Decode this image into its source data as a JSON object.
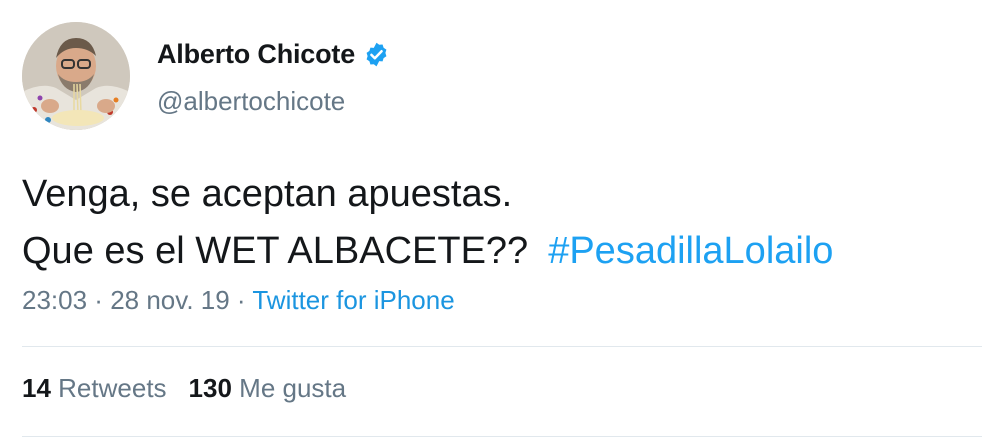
{
  "user": {
    "display_name": "Alberto Chicote",
    "handle": "@albertochicote",
    "verified_icon": "verified-badge-icon",
    "verified_color": "#1da1f2"
  },
  "tweet": {
    "line1": "Venga, se aceptan apuestas.",
    "line2": "Que es el WET ALBACETE??",
    "hashtag": "#PesadillaLolailo",
    "hashtag_color": "#1da1f2"
  },
  "meta": {
    "time": "23:03",
    "separator": " · ",
    "date": "28 nov. 19",
    "source": "Twitter for iPhone"
  },
  "stats": {
    "retweets_count": "14",
    "retweets_label": "Retweets",
    "likes_count": "130",
    "likes_label": "Me gusta"
  },
  "colors": {
    "text": "#14171a",
    "secondary": "#657786",
    "link": "#1b95e0",
    "divider": "#e1e8ed"
  }
}
